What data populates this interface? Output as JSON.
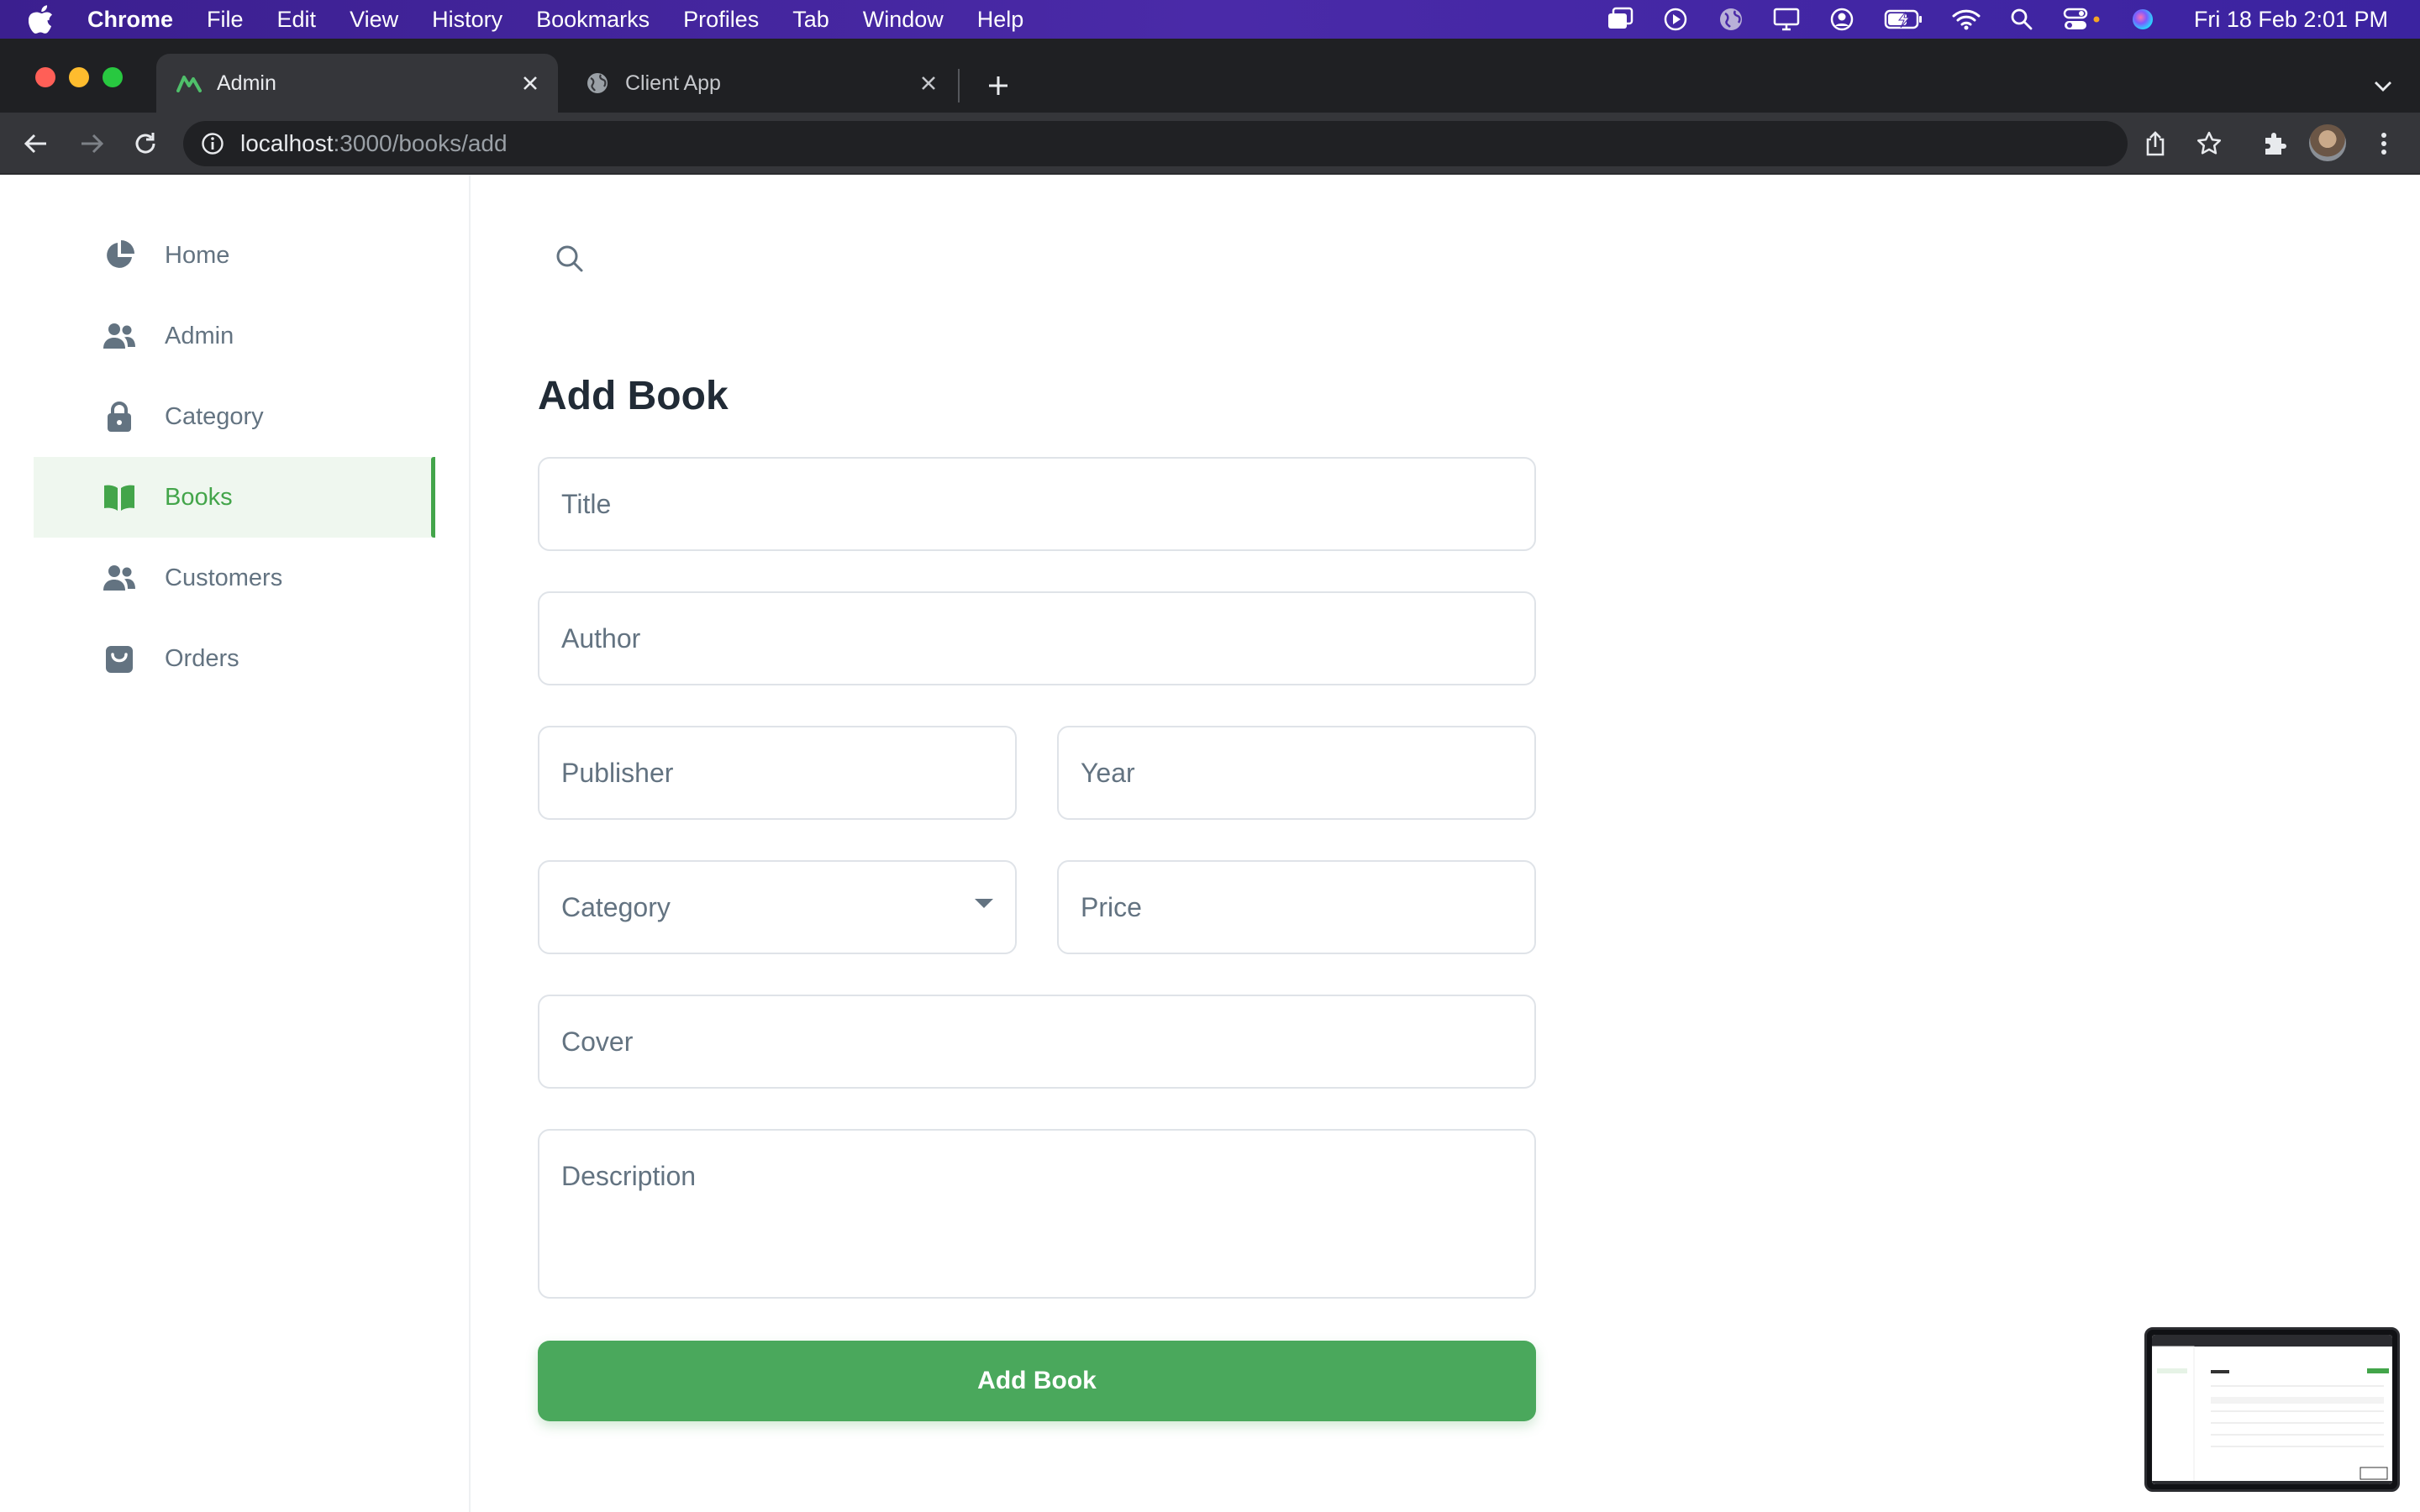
{
  "menubar": {
    "items": [
      "Chrome",
      "File",
      "Edit",
      "View",
      "History",
      "Bookmarks",
      "Profiles",
      "Tab",
      "Window",
      "Help"
    ],
    "datetime": "Fri 18 Feb  2:01 PM",
    "status_icons": [
      "screen-mirror-icon",
      "play-icon",
      "globe-icon",
      "display-icon",
      "user-circle-icon",
      "battery-charging-icon",
      "wifi-icon",
      "spotlight-search-icon",
      "control-center-icon",
      "siri-icon"
    ]
  },
  "browser": {
    "tabs": [
      {
        "title": "Admin",
        "active": true
      },
      {
        "title": "Client App",
        "active": false
      }
    ],
    "url_host": "localhost",
    "url_path": ":3000/books/add"
  },
  "sidebar": {
    "items": [
      {
        "label": "Home",
        "icon": "pie-chart-icon"
      },
      {
        "label": "Admin",
        "icon": "users-icon"
      },
      {
        "label": "Category",
        "icon": "lock-icon"
      },
      {
        "label": "Books",
        "icon": "book-open-icon",
        "active": true
      },
      {
        "label": "Customers",
        "icon": "users-icon"
      },
      {
        "label": "Orders",
        "icon": "shopping-bag-icon"
      }
    ]
  },
  "form": {
    "title": "Add Book",
    "fields": {
      "title": "Title",
      "author": "Author",
      "publisher": "Publisher",
      "year": "Year",
      "category": "Category",
      "price": "Price",
      "cover": "Cover",
      "description": "Description"
    },
    "submit_label": "Add Book"
  },
  "colors": {
    "accent": "#43a54a",
    "button": "#4aa85c",
    "menubar": "#4a2aa8",
    "muted_text": "#637381",
    "heading": "#212b36"
  }
}
